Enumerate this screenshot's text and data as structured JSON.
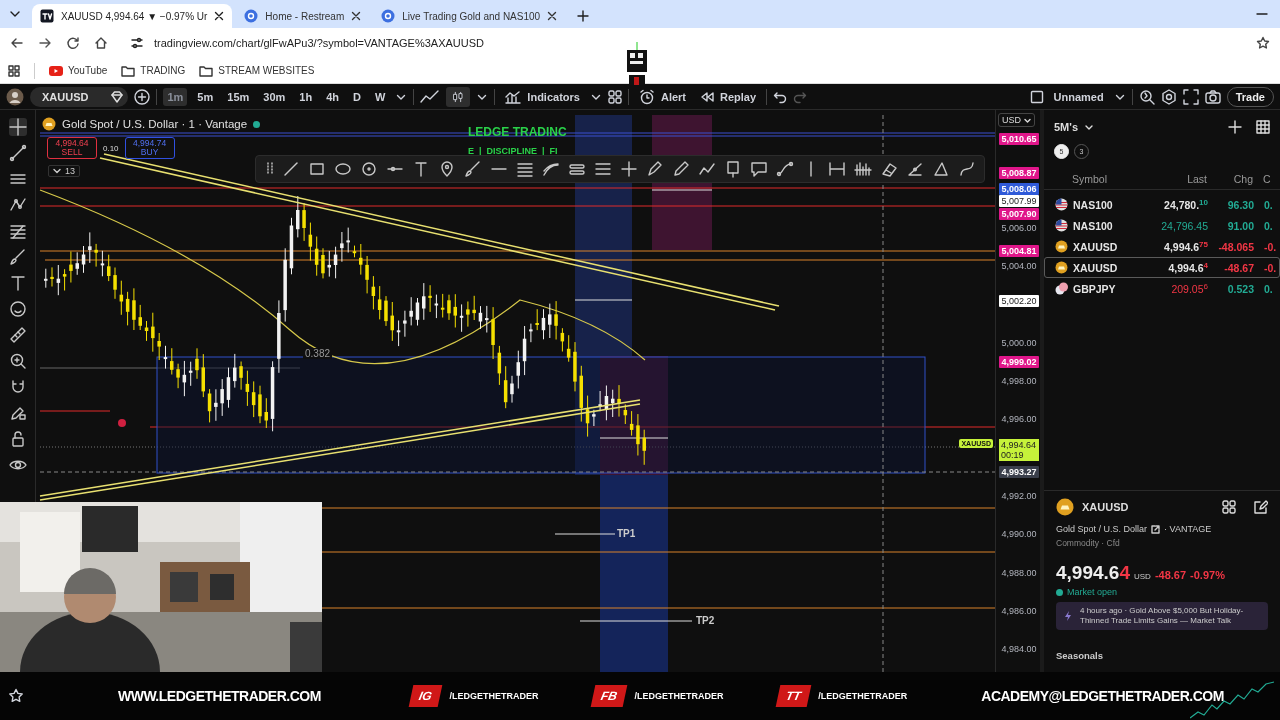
{
  "browser": {
    "tabs": [
      {
        "title": "XAUUSD 4,994.64 ▼ −0.97% Ur",
        "selected": true
      },
      {
        "title": "Home - Restream",
        "selected": false
      },
      {
        "title": "Live Trading Gold and NAS100",
        "selected": false
      }
    ],
    "address": "tradingview.com/chart/glFwAPu3/?symbol=VANTAGE%3AXAUUSD",
    "bookmarks": [
      "YouTube",
      "TRADING",
      "STREAM WEBSITES"
    ]
  },
  "toolbar": {
    "symbol": "XAUUSD",
    "intervals": [
      {
        "label": "1m",
        "selected": true
      },
      {
        "label": "5m",
        "selected": false
      },
      {
        "label": "15m",
        "selected": false
      },
      {
        "label": "30m",
        "selected": false
      },
      {
        "label": "1h",
        "selected": false
      },
      {
        "label": "4h",
        "selected": false
      },
      {
        "label": "D",
        "selected": false
      },
      {
        "label": "W",
        "selected": false
      }
    ],
    "indicators": "Indicators",
    "alert": "Alert",
    "replay": "Replay",
    "layout": "Unnamed",
    "trade": "Trade"
  },
  "chart": {
    "legend": "Gold Spot / U.S. Dollar · 1 · Vantage",
    "sell": {
      "price": "4,994.64",
      "label": "SELL"
    },
    "spread": "0.10",
    "buy": {
      "price": "4,994.74",
      "label": "BUY"
    },
    "indicator_count": "13",
    "overlay_lines": [
      "LEDGE TRADINC",
      "E  |  DISCIPLINE  |  FI"
    ],
    "fib_label": "0.382",
    "targets": [
      "TP1",
      "TP2"
    ]
  },
  "price_axis": {
    "currency": "USD",
    "labels": [
      {
        "text": "5,010.65",
        "color": "#e0168a"
      },
      {
        "text": "5,008.87",
        "color": "#e0168a"
      },
      {
        "text": "5,008.06",
        "color": "#2f5ad8"
      },
      {
        "text": "5,007.99",
        "color": "#ffffff"
      },
      {
        "text": "5,007.90",
        "color": "#e0168a"
      },
      {
        "text": "5,006.00"
      },
      {
        "text": "5,004.81",
        "color": "#e0168a"
      },
      {
        "text": "5,004.00"
      },
      {
        "text": "5,002.20",
        "color": "#ffffff"
      },
      {
        "text": "5,000.00"
      },
      {
        "text": "4,999.02",
        "color": "#e0168a"
      },
      {
        "text": "4,998.00"
      },
      {
        "text": "4,996.00"
      },
      {
        "text": "4,993.27",
        "color": "#3a3f4b"
      },
      {
        "text": "4,992.00"
      },
      {
        "text": "4,990.00"
      },
      {
        "text": "4,988.00"
      },
      {
        "text": "4,986.00"
      },
      {
        "text": "4,984.00"
      }
    ],
    "current": {
      "symbol": "XAUUSD",
      "price": "4,994.64",
      "countdown": "00:19",
      "color": "#c6f23a"
    }
  },
  "watchlist": {
    "title": "5M's",
    "filters": [
      {
        "label": "5",
        "selected": true
      },
      {
        "label": "3",
        "selected": false
      }
    ],
    "columns": [
      "Symbol",
      "Last",
      "Chg",
      "C"
    ],
    "rows": [
      {
        "symbol": "NAS100",
        "last": "24,780.",
        "last_tail": "10",
        "tick_up": true,
        "last_flash": false,
        "change": "96.30",
        "change_pct": "0.",
        "change_up": true,
        "selected": false
      },
      {
        "symbol": "NAS100",
        "last": "24,796.45",
        "tick_up": true,
        "last_flash": true,
        "change": "91.00",
        "change_pct": "0.",
        "change_up": true,
        "selected": false
      },
      {
        "symbol": "XAUUSD",
        "last": "4,994.6",
        "last_tail": "75",
        "tick_up": false,
        "last_flash": false,
        "change": "-48.065",
        "change_pct": "-0.",
        "change_up": false,
        "selected": false
      },
      {
        "symbol": "XAUUSD",
        "last": "4,994.6",
        "last_tail": "4",
        "tick_up": false,
        "last_flash": false,
        "change": "-48.67",
        "change_pct": "-0.",
        "change_up": false,
        "selected": true
      },
      {
        "symbol": "GBPJPY",
        "last": "209.05",
        "last_tail": "6",
        "tick_up": false,
        "last_flash": true,
        "change": "0.523",
        "change_pct": "0.",
        "change_up": true,
        "selected": false
      }
    ]
  },
  "details": {
    "symbol": "XAUUSD",
    "name": "Gold Spot / U.S. Dollar",
    "exchange": "· VANTAGE",
    "type_line": "Commodity · Cfd",
    "price": "4,994.6",
    "price_tail": "4",
    "currency": "USD",
    "change": "-48.67",
    "change_pct": "-0.97%",
    "change_up": false,
    "market_status": "Market open",
    "news": "4 hours ago · Gold Above $5,000 But Holiday-Thinned Trade Limits Gains — Market Talk",
    "section": "Seasonals"
  },
  "banner": {
    "website": "WWW.LEDGETHETRADER.COM",
    "socials": [
      {
        "badge": "IG",
        "handle": "/LEDGETHETRADER"
      },
      {
        "badge": "FB",
        "handle": "/LEDGETHETRADER"
      },
      {
        "badge": "TT",
        "handle": "/LEDGETHETRADER"
      }
    ],
    "email": "ACADEMY@LEDGETHETRADER.COM"
  }
}
